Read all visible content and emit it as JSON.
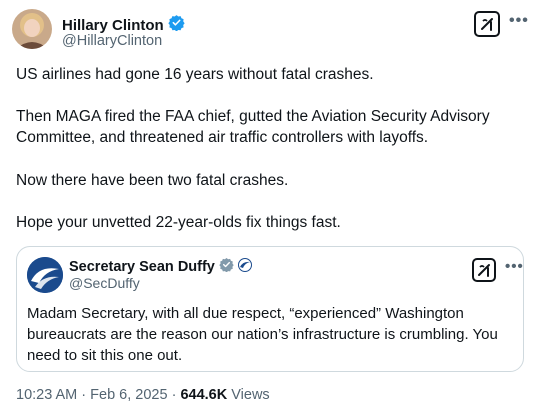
{
  "author": {
    "display_name": "Hillary Clinton",
    "handle": "@HillaryClinton",
    "verified_color": "#1d9bf0"
  },
  "tweet": {
    "paragraphs": [
      "US airlines had gone 16 years without fatal crashes.",
      "Then MAGA fired the FAA chief, gutted the Aviation Security Advisory",
      "Committee, and threatened air traffic controllers with layoffs.",
      "Now there have been two fatal crashes.",
      "Hope your unvetted 22-year-olds fix things fast."
    ]
  },
  "quote": {
    "display_name": "Secretary Sean Duffy",
    "handle": "@SecDuffy",
    "lines": [
      "Madam Secretary, with all due respect, “experienced” Washington",
      "bureaucrats are the reason our nation’s infrastructure is crumbling. You",
      "need to sit this one out."
    ]
  },
  "footer": {
    "time": "10:23 AM",
    "separator": " · ",
    "date": "Feb 6, 2025",
    "separator2": " · ",
    "views_count": "644.6K",
    "views_label": " Views"
  },
  "icons": {
    "grok": "grok-icon",
    "more": "more-icon",
    "verified": "verified-badge-icon",
    "affiliate": "dot-affiliation-icon"
  },
  "colors": {
    "text": "#0f1419",
    "muted": "#536471",
    "border": "#cfd9de",
    "verified_blue": "#1d9bf0",
    "dot_blue": "#1a4a8d"
  }
}
